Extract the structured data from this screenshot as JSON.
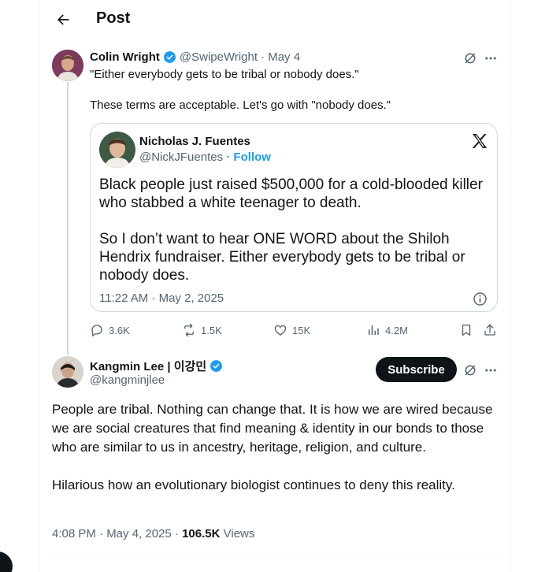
{
  "header": {
    "title": "Post"
  },
  "reply_post": {
    "author_name": "Colin Wright",
    "handle": "@SwipeWright",
    "date": "· May 4",
    "line1": "\"Either everybody gets to be tribal or nobody does.\"",
    "line2": "These terms are acceptable. Let's go with \"nobody does.\"",
    "quote": {
      "author_name": "Nicholas J. Fuentes",
      "handle": "@NickJFuentes",
      "follow_label": "· Follow",
      "paragraph1": "Black people just raised $500,000 for a cold-blooded killer who stabbed a white teenager to death.",
      "paragraph2": "So I don’t want to hear ONE WORD about the Shiloh Hendrix fundraiser. Either everybody gets to be tribal or nobody does.",
      "timestamp": "11:22 AM · May 2, 2025"
    },
    "stats": {
      "replies": "3.6K",
      "reposts": "1.5K",
      "likes": "15K",
      "views": "4.2M"
    }
  },
  "main_post": {
    "author_name": "Kangmin Lee | 이강민",
    "handle": "@kangminjlee",
    "subscribe_label": "Subscribe",
    "text": "People are tribal. Nothing can change that. It is how we are wired because we are social creatures that find meaning & identity in our bonds to those who are similar to us in ancestry, heritage, religion, and culture.\n\nHilarious how an evolutionary biologist continues to deny this reality.",
    "time": "4:08 PM · May 4, 2025 ·",
    "views_count": "106.5K",
    "views_label": "Views"
  },
  "colors": {
    "verified": "#1d9bf0",
    "link": "#1d9bf0",
    "muted": "#536471",
    "border": "#cfd9de"
  }
}
